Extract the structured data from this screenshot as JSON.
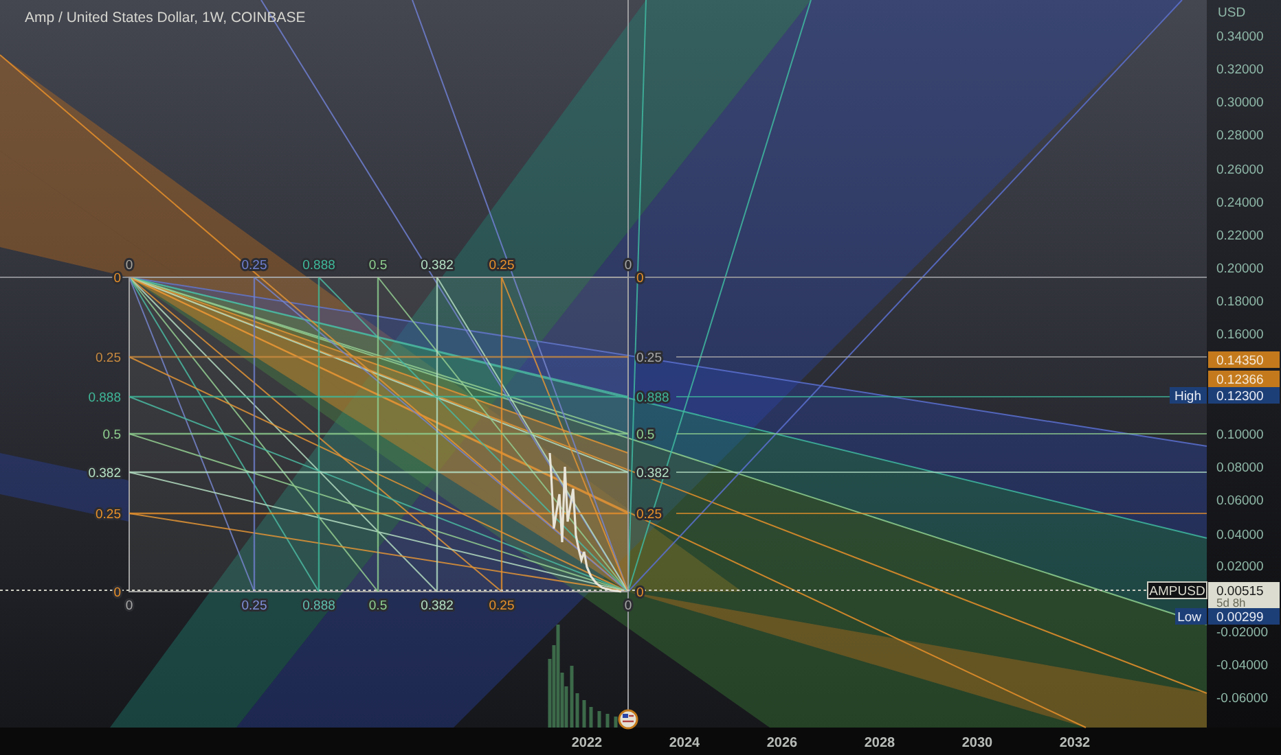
{
  "chart": {
    "title": "Amp / United States Dollar, 1W, COINBASE"
  },
  "gann_box": {
    "top_labels": [
      {
        "text": "0",
        "color": "#a8a49c"
      },
      {
        "text": "0.25",
        "color": "#6f7fd0"
      },
      {
        "text": "0.888",
        "color": "#3fb89a"
      },
      {
        "text": "0.5",
        "color": "#8fd08f"
      },
      {
        "text": "0.382",
        "color": "#b4e0c4"
      },
      {
        "text": "0.25",
        "color": "#e8902a"
      },
      {
        "text": "0",
        "color": "#a8a8a8"
      }
    ],
    "bottom_labels": [
      {
        "text": "0",
        "color": "#a8a8a8"
      },
      {
        "text": "0.25",
        "color": "#7f8fd8"
      },
      {
        "text": "0.888",
        "color": "#5fc0b0"
      },
      {
        "text": "0.5",
        "color": "#8fd08f"
      },
      {
        "text": "0.382",
        "color": "#b4e0c4"
      },
      {
        "text": "0.25",
        "color": "#e8902a"
      },
      {
        "text": "0",
        "color": "#a8a8a8"
      }
    ],
    "left_labels": [
      {
        "text": "0",
        "color": "#e8902a"
      },
      {
        "text": "0.25",
        "color": "#c88a40"
      },
      {
        "text": "0.888",
        "color": "#3fb89a"
      },
      {
        "text": "0.5",
        "color": "#8fd08f"
      },
      {
        "text": "0.382",
        "color": "#b4e0c4"
      },
      {
        "text": "0.25",
        "color": "#e8902a"
      },
      {
        "text": "0",
        "color": "#e8902a"
      }
    ],
    "right_labels": [
      {
        "text": "0",
        "color": "#e8902a"
      },
      {
        "text": "0.25",
        "color": "#a8a8a8"
      },
      {
        "text": "0.888",
        "color": "#3fb89a"
      },
      {
        "text": "0.5",
        "color": "#8fd08f"
      },
      {
        "text": "0.382",
        "color": "#b4e0c4"
      },
      {
        "text": "0.25",
        "color": "#e8902a"
      },
      {
        "text": "0",
        "color": "#e8902a"
      }
    ]
  },
  "price_axis": {
    "unit": "USD",
    "ticks": [
      "0.34000",
      "0.32000",
      "0.30000",
      "0.28000",
      "0.26000",
      "0.24000",
      "0.22000",
      "0.20000",
      "0.18000",
      "0.16000",
      "0.10000",
      "0.08000",
      "0.06000",
      "0.04000",
      "0.02000",
      "-0.02000",
      "-0.04000",
      "-0.06000"
    ]
  },
  "price_tags": [
    {
      "kind": "level",
      "value": "0.14350",
      "color": "#c47a1c"
    },
    {
      "kind": "level",
      "value": "0.12366",
      "color": "#c47a1c"
    },
    {
      "kind": "high",
      "label": "High",
      "value": "0.12300",
      "color": "#1d3f78"
    },
    {
      "kind": "current",
      "label": "AMPUSD",
      "value": "0.00515",
      "countdown": "5d 8h",
      "color": "#dcdcd0"
    },
    {
      "kind": "low",
      "label": "Low",
      "value": "0.00299",
      "color": "#1d3f78"
    }
  ],
  "time_axis": {
    "ticks": [
      "2022",
      "2024",
      "2026",
      "2028",
      "2030",
      "2032"
    ]
  }
}
